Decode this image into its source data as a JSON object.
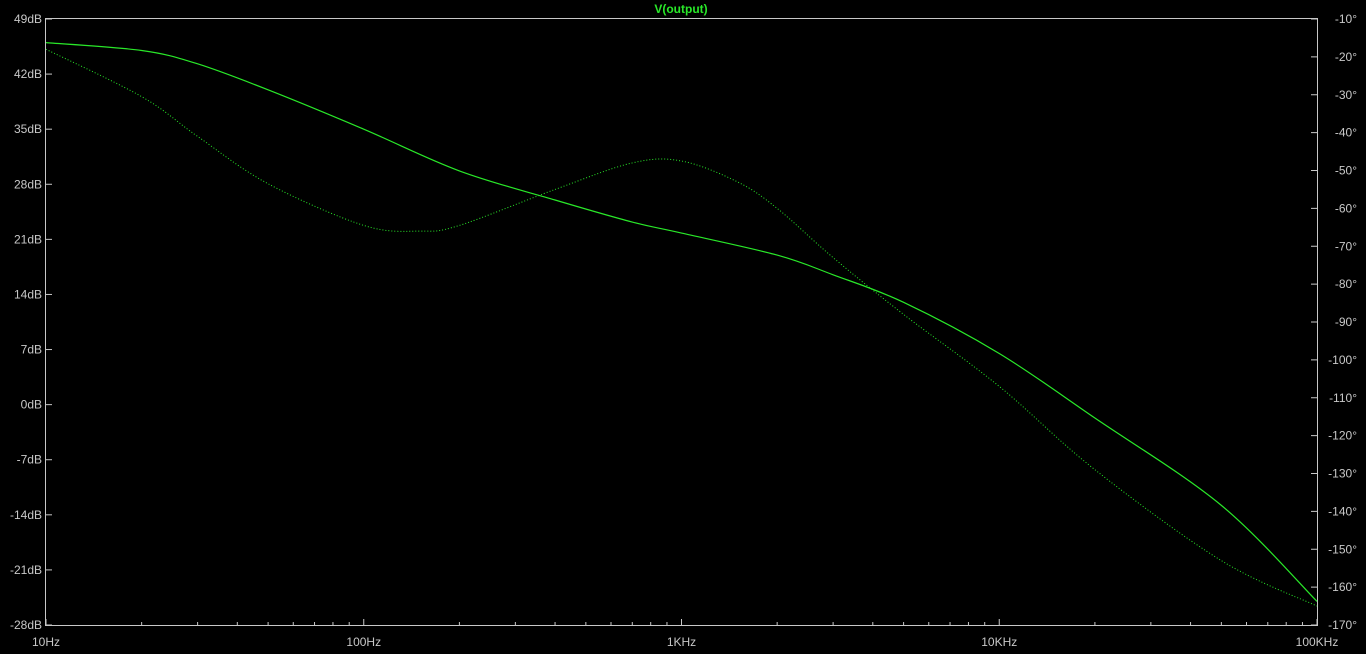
{
  "chart_data": {
    "type": "line",
    "title": "V(output)",
    "x_scale": "log",
    "xlim": [
      "10Hz",
      "100KHz"
    ],
    "x_tick_labels": [
      "10Hz",
      "100Hz",
      "1KHz",
      "10KHz",
      "100KHz"
    ],
    "y_left": {
      "unit": "dB",
      "ylim": [
        -28,
        49
      ],
      "tick_labels": [
        "49dB",
        "42dB",
        "35dB",
        "28dB",
        "21dB",
        "14dB",
        "7dB",
        "0dB",
        "-7dB",
        "-14dB",
        "-21dB",
        "-28dB"
      ]
    },
    "y_right": {
      "unit": "degrees",
      "ylim": [
        -170,
        -10
      ],
      "tick_labels": [
        "-10°",
        "-20°",
        "-30°",
        "-40°",
        "-50°",
        "-60°",
        "-70°",
        "-80°",
        "-90°",
        "-100°",
        "-110°",
        "-120°",
        "-130°",
        "-140°",
        "-150°",
        "-160°",
        "-170°"
      ]
    },
    "grid": false,
    "colors": {
      "background": "#000000",
      "frame": "#c8c8c8",
      "title": "#29e829",
      "trace": "#29e829"
    },
    "series": [
      {
        "quantity": "magnitude",
        "axis": "left",
        "style": "solid",
        "x": [
          10,
          20,
          30,
          50,
          100,
          200,
          400,
          700,
          1000,
          2000,
          3000,
          5000,
          10000,
          20000,
          50000,
          100000
        ],
        "y": [
          46,
          45,
          43.3,
          40,
          35,
          29.7,
          26,
          23.2,
          21.8,
          19,
          16.5,
          13,
          6.5,
          -1.7,
          -12.8,
          -25
        ]
      },
      {
        "quantity": "phase",
        "axis": "right",
        "style": "dotted",
        "x": [
          10,
          20,
          30,
          50,
          100,
          150,
          200,
          400,
          700,
          1000,
          1500,
          2000,
          3000,
          5000,
          10000,
          20000,
          50000,
          100000
        ],
        "y": [
          -18,
          -30.5,
          -41,
          -53.5,
          -64.5,
          -66,
          -64.5,
          -55,
          -48,
          -47.5,
          -53,
          -60,
          -73,
          -88,
          -107,
          -129,
          -153,
          -165
        ]
      }
    ]
  }
}
